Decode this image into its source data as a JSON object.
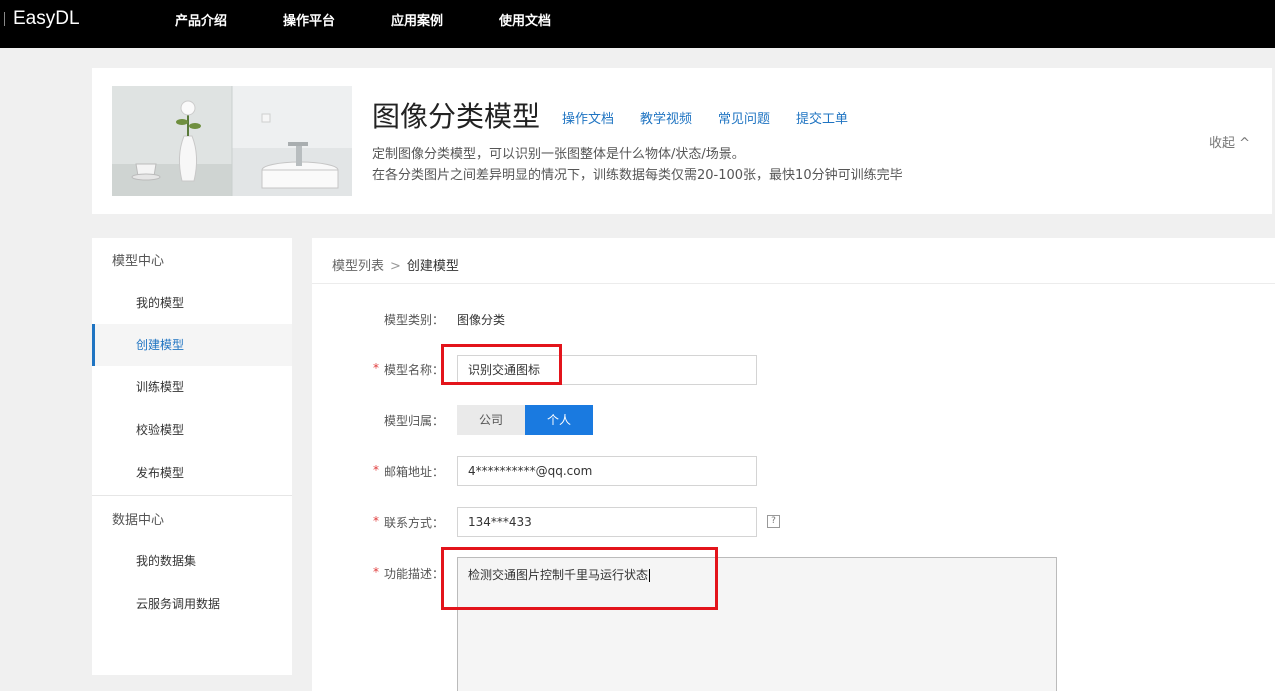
{
  "nav": {
    "logo": "EasyDL",
    "items": [
      "产品介绍",
      "操作平台",
      "应用案例",
      "使用文档"
    ]
  },
  "hero": {
    "title": "图像分类模型",
    "links": [
      "操作文档",
      "教学视频",
      "常见问题",
      "提交工单"
    ],
    "desc1": "定制图像分类模型，可以识别一张图整体是什么物体/状态/场景。",
    "desc2": "在各分类图片之间差异明显的情况下，训练数据每类仅需20-100张，最快10分钟可训练完毕",
    "collapse": "收起 ^"
  },
  "sidebar": {
    "model_center": "模型中心",
    "model_items": [
      "我的模型",
      "创建模型",
      "训练模型",
      "校验模型",
      "发布模型"
    ],
    "active_index": 1,
    "data_center": "数据中心",
    "data_items": [
      "我的数据集",
      "云服务调用数据"
    ]
  },
  "breadcrumb": {
    "parent": "模型列表",
    "separator": ">",
    "current": "创建模型"
  },
  "form": {
    "category_label": "模型类别：",
    "category_value": "图像分类",
    "name_label": "模型名称：",
    "name_value": "识别交通图标",
    "owner_label": "模型归属：",
    "owner_options": [
      "公司",
      "个人"
    ],
    "owner_selected": "个人",
    "email_label": "邮箱地址：",
    "email_value": "4**********@qq.com",
    "phone_label": "联系方式：",
    "phone_value": "134***433",
    "help_icon": "?",
    "desc_label": "功能描述：",
    "desc_value": "检测交通图片控制千里马运行状态",
    "required_mark": "*"
  },
  "colors": {
    "accent": "#1a7ae0",
    "link": "#1f74c2",
    "highlight": "#e3141b",
    "required": "#e03c3c"
  }
}
